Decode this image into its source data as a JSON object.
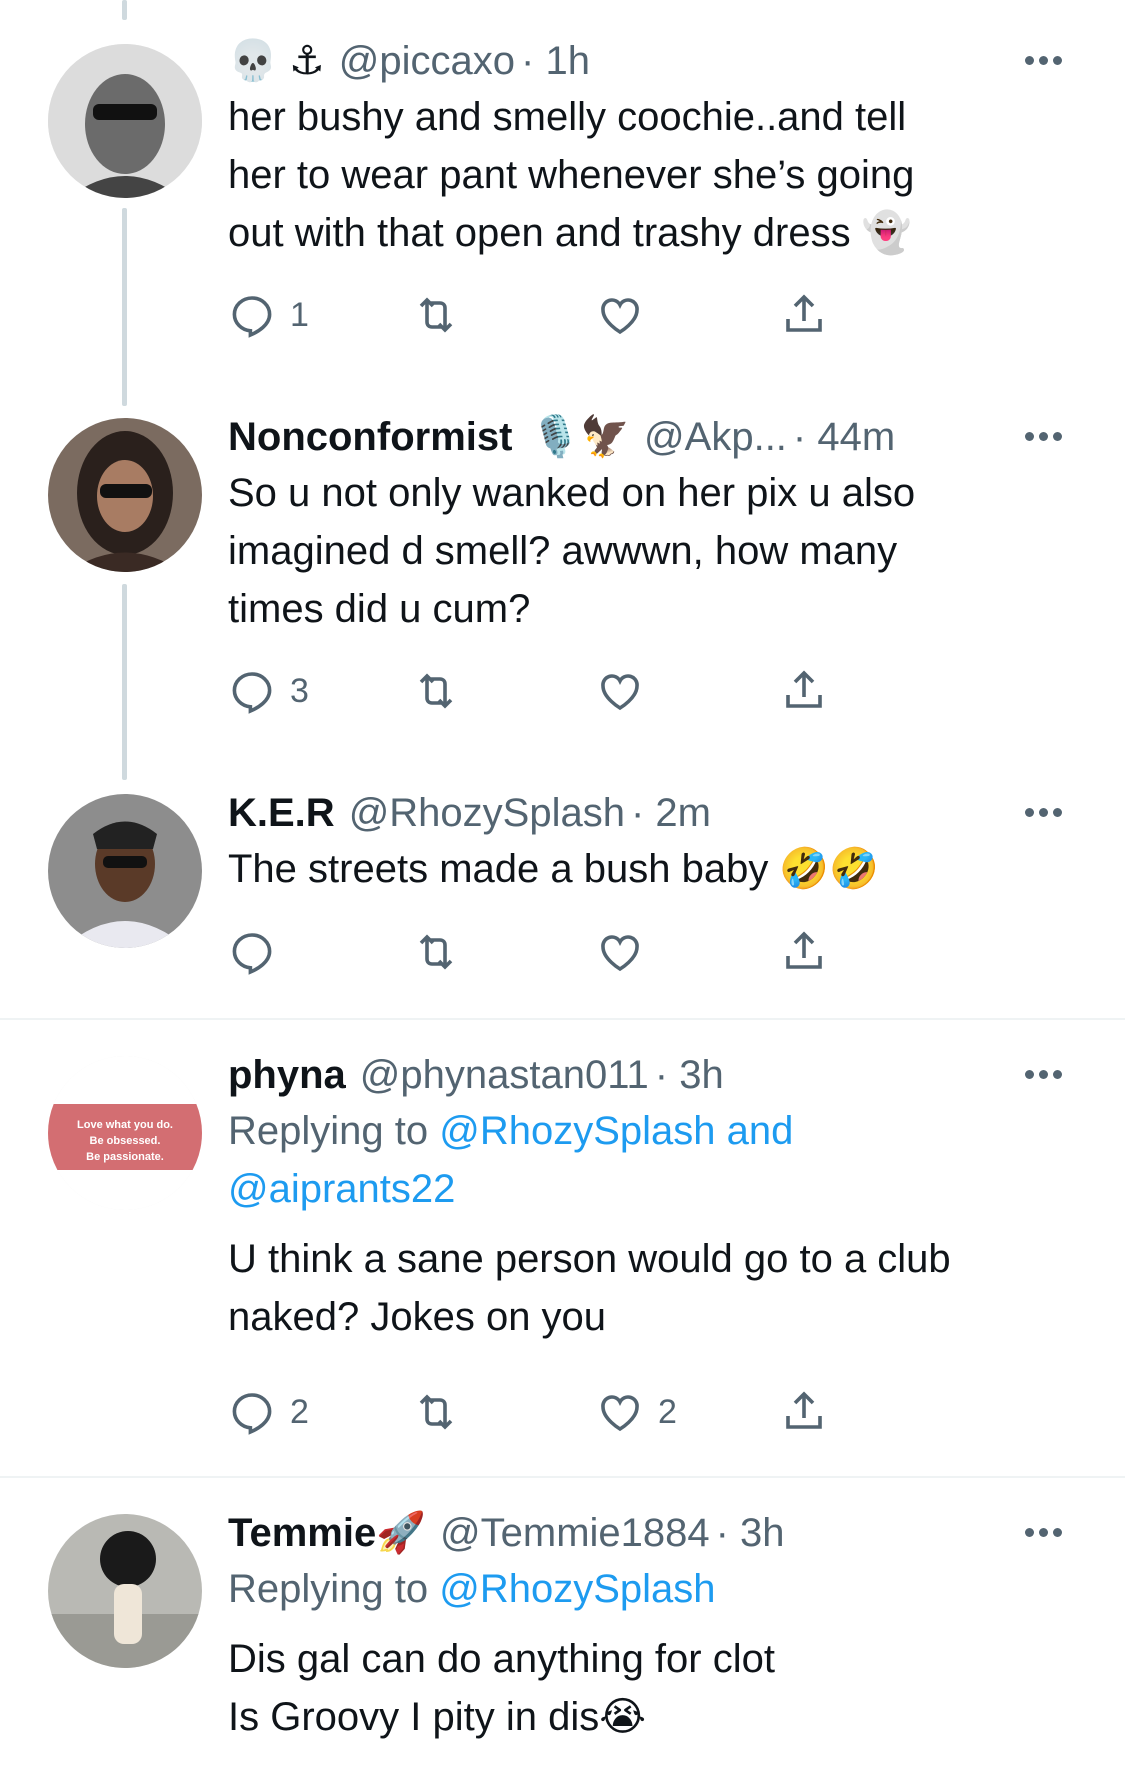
{
  "tweets": [
    {
      "name": "",
      "name_emojis": "💀 ⚓",
      "handle": "@piccaxo",
      "time": "· 1h",
      "lines": [
        "her bushy and smelly coochie..and tell",
        "her to wear pant whenever she’s going",
        "out with that open and trashy dress 👻"
      ],
      "reply_count": "1",
      "retweet_count": "",
      "like_count": ""
    },
    {
      "name": "Nonconformist",
      "name_emojis": "🎙️🦅",
      "handle": "@Akp...",
      "time": "· 44m",
      "lines": [
        "So u not only wanked on her pix u also",
        "imagined d smell? awwwn, how many",
        "times did u cum?"
      ],
      "reply_count": "3",
      "retweet_count": "",
      "like_count": ""
    },
    {
      "name": "K.E.R",
      "name_emojis": "",
      "handle": "@RhozySplash",
      "time": "· 2m",
      "lines": [
        "The streets made a bush baby 🤣🤣"
      ],
      "reply_count": "",
      "retweet_count": "",
      "like_count": ""
    },
    {
      "name": "phyna",
      "name_emojis": "",
      "handle": "@phynastan011",
      "time": "· 3h",
      "replying_prefix": "Replying to",
      "replying_links": "@RhozySplash and",
      "replying_links_2": "@aiprants22",
      "lines": [
        "U think a sane person would go to a club",
        "naked? Jokes on you"
      ],
      "reply_count": "2",
      "retweet_count": "",
      "like_count": "2",
      "avatar_text": [
        "Love what you do.",
        "Be obsessed.",
        "Be passionate."
      ]
    },
    {
      "name": "Temmie",
      "name_emojis": "🚀",
      "handle": "@Temmie1884",
      "time": "· 3h",
      "replying_prefix": "Replying to",
      "replying_links": "@RhozySplash",
      "lines": [
        "Dis gal can do anything for clot",
        "Is Groovy I pity in dis😭"
      ]
    }
  ],
  "colors": {
    "text": "#0f1419",
    "muted": "#536471",
    "link": "#1d9bf0",
    "thread_line": "#cfd9de",
    "divider": "#eff3f4"
  },
  "icons": [
    "reply-icon",
    "retweet-icon",
    "like-icon",
    "share-icon",
    "more-icon"
  ]
}
